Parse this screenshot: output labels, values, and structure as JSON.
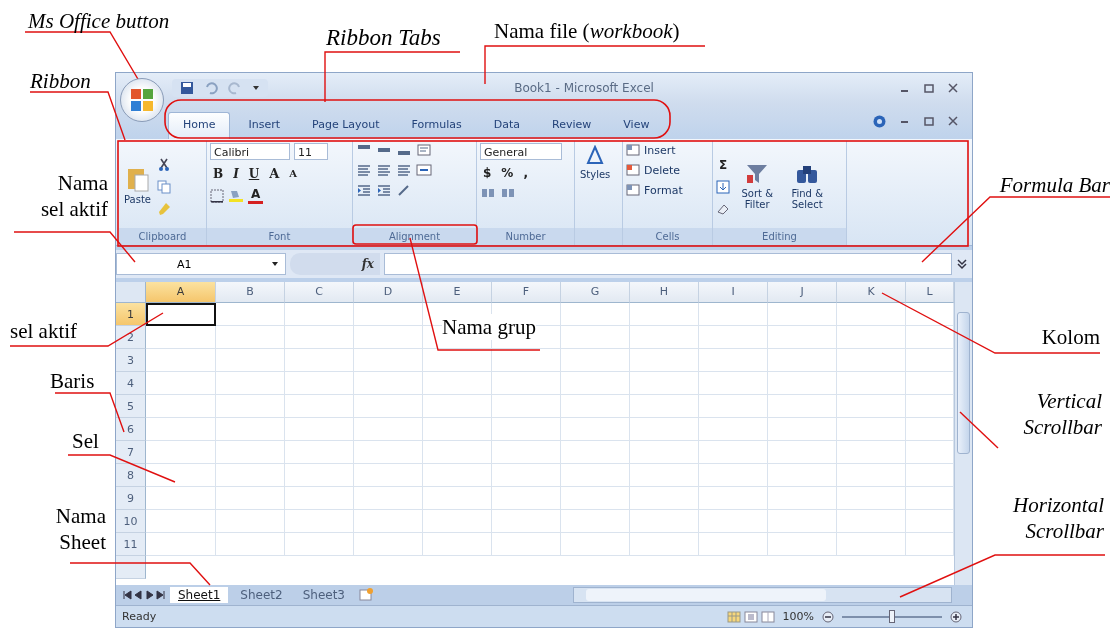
{
  "annotations": [
    {
      "text": "Ms Office button",
      "kind": "italic"
    },
    {
      "text": "Ribbon Tabs",
      "kind": "italic"
    },
    {
      "text": "Nama file (*workbook*)",
      "kind": "plain"
    },
    {
      "text": "Ribbon",
      "kind": "italic"
    },
    {
      "text": "Nama sel aktif",
      "kind": "plain"
    },
    {
      "text": "Formula Bar",
      "kind": "italic"
    },
    {
      "text": "sel aktif",
      "kind": "plain"
    },
    {
      "text": "Nama grup",
      "kind": "plain"
    },
    {
      "text": "Kolom",
      "kind": "plain"
    },
    {
      "text": "Baris",
      "kind": "plain"
    },
    {
      "text": "Vertical Scrollbar",
      "kind": "italic"
    },
    {
      "text": "Sel",
      "kind": "plain"
    },
    {
      "text": "Horizontal Scrollbar",
      "kind": "italic"
    },
    {
      "text": "Nama Sheet",
      "kind": "plain"
    }
  ],
  "window": {
    "title": "Book1 - Microsoft Excel"
  },
  "ribbon_tabs": [
    {
      "label": "Home",
      "selected": true
    },
    {
      "label": "Insert",
      "selected": false
    },
    {
      "label": "Page Layout",
      "selected": false
    },
    {
      "label": "Formulas",
      "selected": false
    },
    {
      "label": "Data",
      "selected": false
    },
    {
      "label": "Review",
      "selected": false
    },
    {
      "label": "View",
      "selected": false
    }
  ],
  "ribbon": {
    "clipboard": {
      "paste": "Paste",
      "label": "Clipboard"
    },
    "font": {
      "name": "Calibri",
      "size": "11",
      "format_buttons": [
        "B",
        "I",
        "U"
      ],
      "size_buttons": [
        "A",
        "A"
      ],
      "color_button": "A",
      "label": "Font"
    },
    "alignment": {
      "label": "Alignment"
    },
    "number": {
      "format": "General",
      "buttons": [
        "$",
        "%",
        ","
      ],
      "label": "Number"
    },
    "styles": {
      "label": "Styles"
    },
    "cells": {
      "buttons": [
        "Insert",
        "Delete",
        "Format"
      ],
      "label": "Cells"
    },
    "editing": {
      "sum": "Σ",
      "buttons": [
        "Sort & Filter",
        "Find & Select"
      ],
      "label": "Editing"
    }
  },
  "formula_bar": {
    "name_box": "A1",
    "function_label": "fx"
  },
  "sheet": {
    "columns": [
      {
        "label": "A",
        "selected": true
      },
      {
        "label": "B",
        "selected": false
      },
      {
        "label": "C",
        "selected": false
      },
      {
        "label": "D",
        "selected": false
      },
      {
        "label": "E",
        "selected": false
      },
      {
        "label": "F",
        "selected": false
      },
      {
        "label": "G",
        "selected": false
      },
      {
        "label": "H",
        "selected": false
      },
      {
        "label": "I",
        "selected": false
      },
      {
        "label": "J",
        "selected": false
      },
      {
        "label": "K",
        "selected": false
      },
      {
        "label": "L",
        "selected": false
      }
    ],
    "rows": [
      {
        "label": "1",
        "selected": true
      },
      {
        "label": "2",
        "selected": false
      },
      {
        "label": "3",
        "selected": false
      },
      {
        "label": "4",
        "selected": false
      },
      {
        "label": "5",
        "selected": false
      },
      {
        "label": "6",
        "selected": false
      },
      {
        "label": "7",
        "selected": false
      },
      {
        "label": "8",
        "selected": false
      },
      {
        "label": "9",
        "selected": false
      },
      {
        "label": "10",
        "selected": false
      },
      {
        "label": "11",
        "selected": false
      }
    ]
  },
  "sheet_tabs": [
    {
      "label": "Sheet1",
      "selected": true
    },
    {
      "label": "Sheet2",
      "selected": false
    },
    {
      "label": "Sheet3",
      "selected": false
    }
  ],
  "status_bar": {
    "text": "Ready",
    "zoom": "100%",
    "zoom_slider": {
      "level": 0.5
    }
  }
}
